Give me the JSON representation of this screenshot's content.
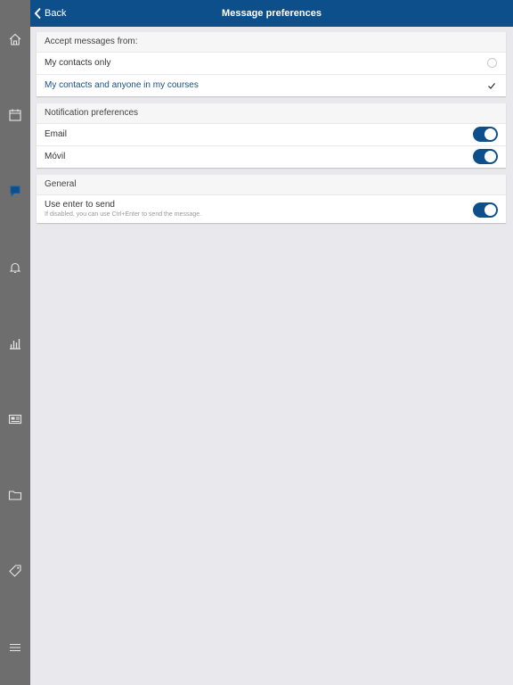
{
  "header": {
    "back_label": "Back",
    "title": "Message preferences",
    "color": "#0d4f8b"
  },
  "sidebar": {
    "icons": [
      "home-icon",
      "calendar-icon",
      "messages-icon",
      "bell-icon",
      "grades-icon",
      "news-icon",
      "folder-icon",
      "tag-icon",
      "menu-icon"
    ],
    "active": "messages-icon"
  },
  "accept_messages": {
    "heading": "Accept messages from:",
    "options": [
      {
        "label": "My contacts only",
        "selected": false
      },
      {
        "label": "My contacts and anyone in my courses",
        "selected": true
      }
    ]
  },
  "notification_preferences": {
    "heading": "Notification preferences",
    "items": [
      {
        "label": "Email",
        "enabled": true
      },
      {
        "label": "Móvil",
        "enabled": true
      }
    ]
  },
  "general": {
    "heading": "General",
    "enter_to_send": {
      "label": "Use enter to send",
      "hint": "If disabled, you can use Ctrl+Enter to send the message.",
      "enabled": true
    }
  }
}
